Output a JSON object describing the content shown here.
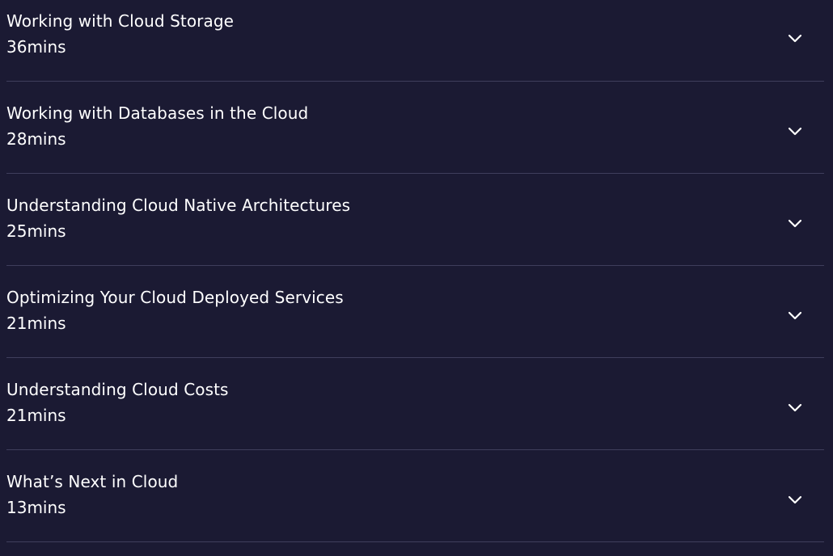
{
  "modules": [
    {
      "title": "Working with Cloud Storage",
      "duration": "36mins",
      "icon": "chevron-down-icon"
    },
    {
      "title": "Working with Databases in the Cloud",
      "duration": "28mins",
      "icon": "chevron-down-icon"
    },
    {
      "title": "Understanding Cloud Native Architectures",
      "duration": "25mins",
      "icon": "chevron-down-icon"
    },
    {
      "title": "Optimizing Your Cloud Deployed Services",
      "duration": "21mins",
      "icon": "chevron-down-icon"
    },
    {
      "title": "Understanding Cloud Costs",
      "duration": "21mins",
      "icon": "chevron-down-icon"
    },
    {
      "title": "What’s Next in Cloud",
      "duration": "13mins",
      "icon": "chevron-down-icon"
    }
  ],
  "colors": {
    "background": "#1b1a33",
    "text": "#ffffff",
    "divider": "#3f3e5c"
  }
}
